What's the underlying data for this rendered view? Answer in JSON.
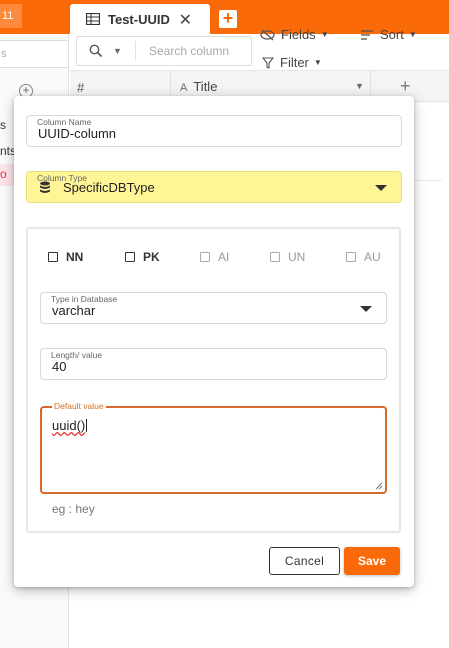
{
  "topbar": {
    "badge": "11",
    "tab_label": "Test-UUID",
    "tab_close": "✕",
    "add_tab": "+"
  },
  "sidebar": {
    "search_placeholder": "s",
    "plus": "+",
    "items": [
      "s",
      "nts",
      "o"
    ]
  },
  "toolbar": {
    "search_placeholder": "Search  column",
    "fields_label": "Fields",
    "sort_label": "Sort",
    "filter_label": "Filter"
  },
  "grid": {
    "hash_col": "#",
    "title_col": "Title",
    "add_col": "+"
  },
  "modal": {
    "column_name": {
      "label": "Column Name",
      "value": "UUID-column"
    },
    "column_type": {
      "label": "Column Type",
      "value": "SpecificDBType"
    },
    "checkboxes": [
      {
        "label": "NN",
        "enabled": true
      },
      {
        "label": "PK",
        "enabled": true
      },
      {
        "label": "AI",
        "enabled": false
      },
      {
        "label": "UN",
        "enabled": false
      },
      {
        "label": "AU",
        "enabled": false
      }
    ],
    "db_type": {
      "label": "Type in Database",
      "value": "varchar"
    },
    "length": {
      "label": "Length/ value",
      "value": "40"
    },
    "default_value": {
      "label": "Default value",
      "value": "uuid()"
    },
    "hint": "eg : hey",
    "cancel_label": "Cancel",
    "save_label": "Save"
  },
  "colors": {
    "brand": "#fb6a09",
    "type_bg": "#fff596",
    "focus_border": "#d66a2b"
  }
}
